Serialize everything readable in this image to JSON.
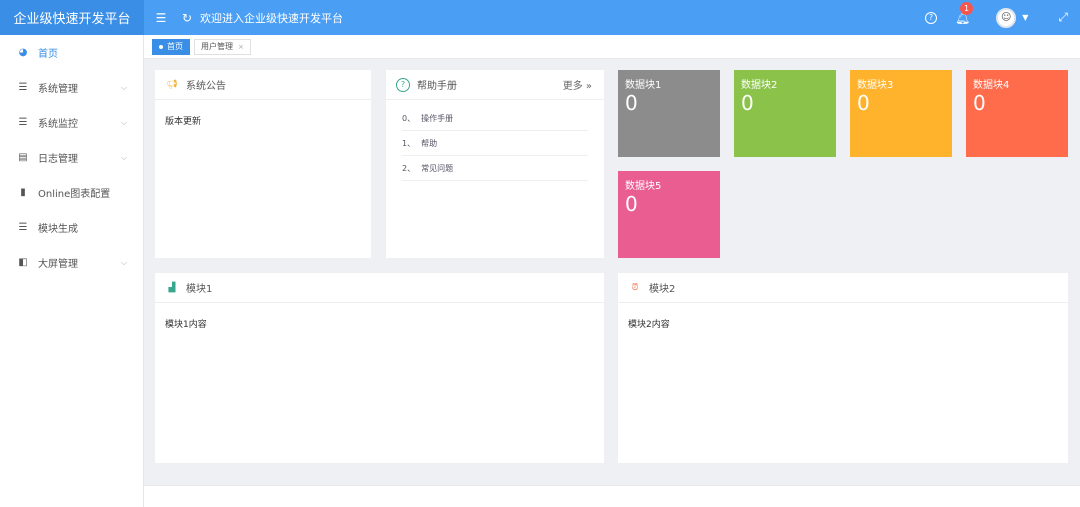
{
  "app": {
    "title": "企业级快速开发平台"
  },
  "header": {
    "welcome": "欢迎进入企业级快速开发平台",
    "notification_count": "1"
  },
  "sidebar": {
    "items": [
      {
        "label": "首页",
        "icon": "dashboard-icon",
        "active": true
      },
      {
        "label": "系统管理",
        "icon": "list-icon"
      },
      {
        "label": "系统监控",
        "icon": "list-icon"
      },
      {
        "label": "日志管理",
        "icon": "log-icon"
      },
      {
        "label": "Online图表配置",
        "icon": "bar-chart-icon"
      },
      {
        "label": "模块生成",
        "icon": "list-icon"
      },
      {
        "label": "大屏管理",
        "icon": "screen-icon"
      }
    ]
  },
  "tabs": [
    {
      "label": "首页",
      "active": true
    },
    {
      "label": "用户管理",
      "closable": true
    }
  ],
  "notice": {
    "title": "系统公告",
    "content": "版本更新"
  },
  "help": {
    "title": "帮助手册",
    "more": "更多 »",
    "items": [
      {
        "num": "0、",
        "label": "操作手册"
      },
      {
        "num": "1、",
        "label": "帮助"
      },
      {
        "num": "2、",
        "label": "常见问题"
      }
    ]
  },
  "data_blocks": [
    {
      "title": "数据块1",
      "value": "0",
      "color": "#8c8c8c"
    },
    {
      "title": "数据块2",
      "value": "0",
      "color": "#8bc34a"
    },
    {
      "title": "数据块3",
      "value": "0",
      "color": "#ffb22b"
    },
    {
      "title": "数据块4",
      "value": "0",
      "color": "#ff6c4c"
    },
    {
      "title": "数据块5",
      "value": "0",
      "color": "#e95d91"
    }
  ],
  "module1": {
    "title": "模块1",
    "content": "模块1内容"
  },
  "module2": {
    "title": "模块2",
    "content": "模块2内容"
  },
  "colors": {
    "primary": "#3a8ee6",
    "header": "#4a9ff5"
  }
}
